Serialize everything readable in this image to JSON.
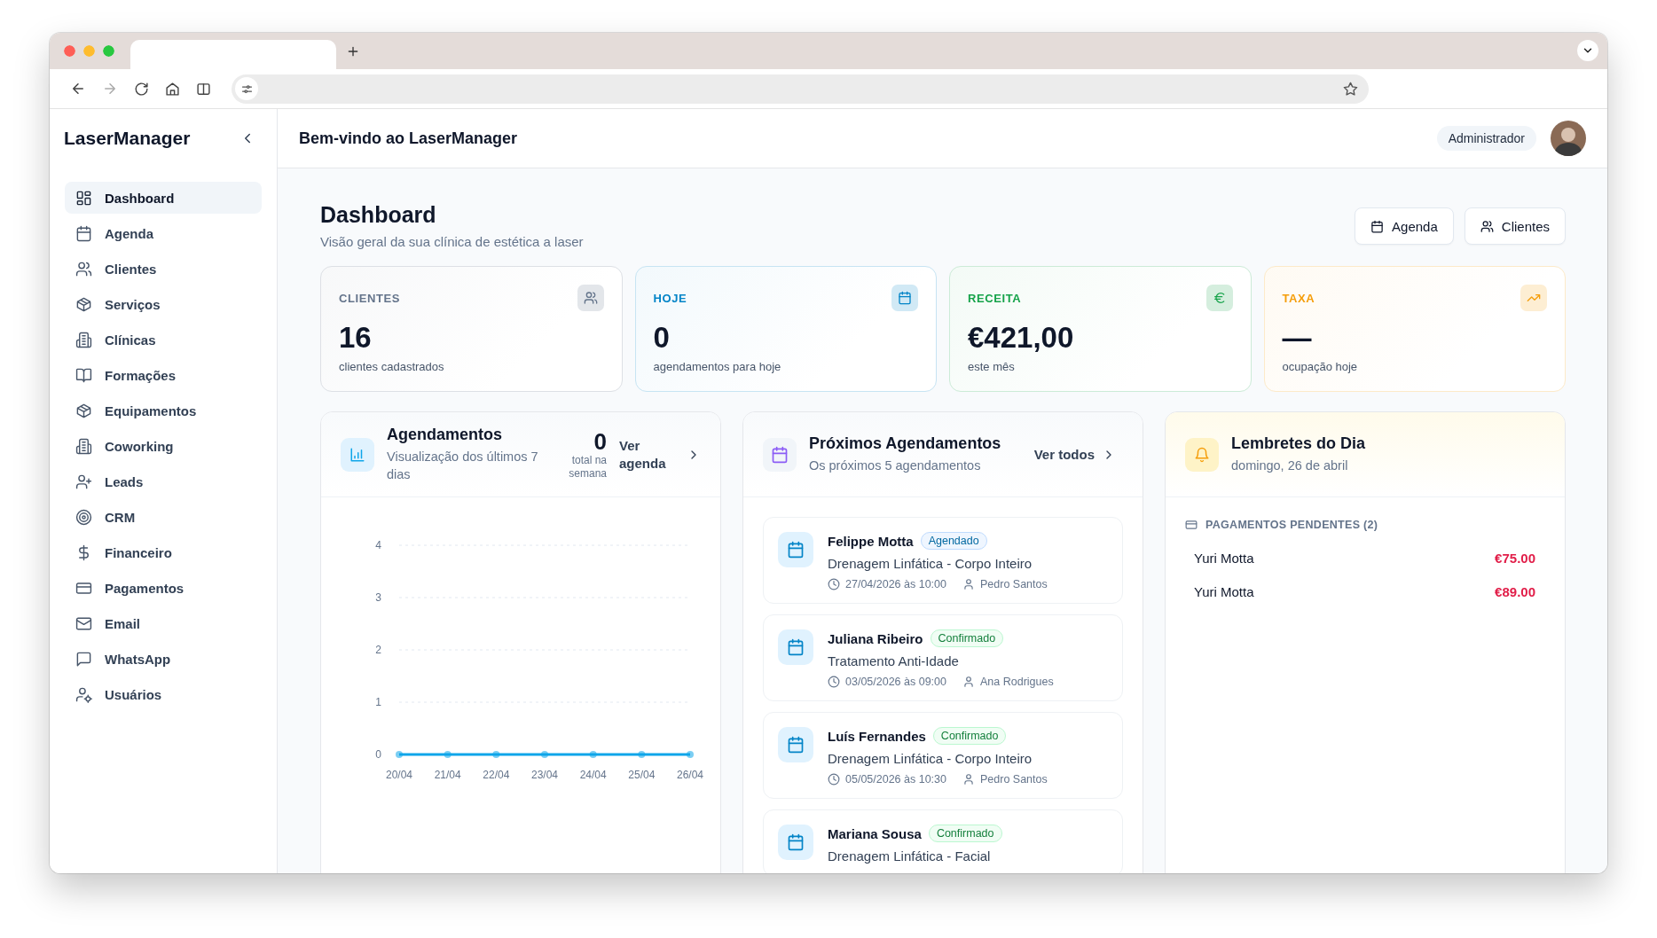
{
  "brand": {
    "name": "LaserManager"
  },
  "header": {
    "title": "Bem-vindo ao LaserManager",
    "role": "Administrador"
  },
  "sidebar": {
    "items": [
      {
        "label": "Dashboard",
        "selected": true
      },
      {
        "label": "Agenda",
        "selected": false
      },
      {
        "label": "Clientes",
        "selected": false
      },
      {
        "label": "Serviços",
        "selected": false
      },
      {
        "label": "Clínicas",
        "selected": false
      },
      {
        "label": "Formações",
        "selected": false
      },
      {
        "label": "Equipamentos",
        "selected": false
      },
      {
        "label": "Coworking",
        "selected": false
      },
      {
        "label": "Leads",
        "selected": false
      },
      {
        "label": "CRM",
        "selected": false
      },
      {
        "label": "Financeiro",
        "selected": false
      },
      {
        "label": "Pagamentos",
        "selected": false
      },
      {
        "label": "Email",
        "selected": false
      },
      {
        "label": "WhatsApp",
        "selected": false
      },
      {
        "label": "Usuários",
        "selected": false
      }
    ]
  },
  "page": {
    "title": "Dashboard",
    "subtitle": "Visão geral da sua clínica de estética a laser",
    "actions": [
      "Agenda",
      "Clientes"
    ]
  },
  "stats": [
    {
      "label": "CLIENTES",
      "value": "16",
      "caption": "clientes cadastrados",
      "color": "#64748b"
    },
    {
      "label": "HOJE",
      "value": "0",
      "caption": "agendamentos para hoje",
      "color": "#0284c7"
    },
    {
      "label": "RECEITA",
      "value": "€421,00",
      "caption": "este mês",
      "color": "#16a34a"
    },
    {
      "label": "TAXA",
      "value": "—",
      "caption": "ocupação hoje",
      "color": "#f59e0b"
    }
  ],
  "appointments_chart": {
    "title": "Agendamentos",
    "subtitle": "Visualização dos últimos 7 dias",
    "total": "0",
    "total_label": "total na semana",
    "link": "Ver agenda",
    "chart_data": {
      "type": "line",
      "categories": [
        "20/04",
        "21/04",
        "22/04",
        "23/04",
        "24/04",
        "25/04",
        "26/04"
      ],
      "series": [
        {
          "color": "#0ea5e9",
          "marker": "circle",
          "values": [
            0,
            0,
            0,
            0,
            0,
            0,
            0
          ]
        }
      ],
      "ylim": [
        0,
        4
      ],
      "yticks": [
        0,
        1,
        2,
        3,
        4
      ],
      "grid": true
    }
  },
  "upcoming": {
    "title": "Próximos Agendamentos",
    "subtitle": "Os próximos 5 agendamentos",
    "link": "Ver todos",
    "items": [
      {
        "client": "Felippe Motta",
        "status": "Agendado",
        "kind": "scheduled",
        "service": "Drenagem Linfática - Corpo Inteiro",
        "datetime": "27/04/2026 às 10:00",
        "staff": "Pedro Santos"
      },
      {
        "client": "Juliana Ribeiro",
        "status": "Confirmado",
        "kind": "confirmed",
        "service": "Tratamento Anti-Idade",
        "datetime": "03/05/2026 às 09:00",
        "staff": "Ana Rodrigues"
      },
      {
        "client": "Luís Fernandes",
        "status": "Confirmado",
        "kind": "confirmed",
        "service": "Drenagem Linfática - Corpo Inteiro",
        "datetime": "05/05/2026 às 10:30",
        "staff": "Pedro Santos"
      },
      {
        "client": "Mariana Sousa",
        "status": "Confirmado",
        "kind": "confirmed",
        "service": "Drenagem Linfática - Facial"
      }
    ]
  },
  "reminders": {
    "title": "Lembretes do Dia",
    "date": "domingo, 26 de abril",
    "section": "PAGAMENTOS PENDENTES (2)",
    "payments": [
      {
        "name": "Yuri Motta",
        "amount": "€75.00"
      },
      {
        "name": "Yuri Motta",
        "amount": "€89.00"
      }
    ]
  }
}
